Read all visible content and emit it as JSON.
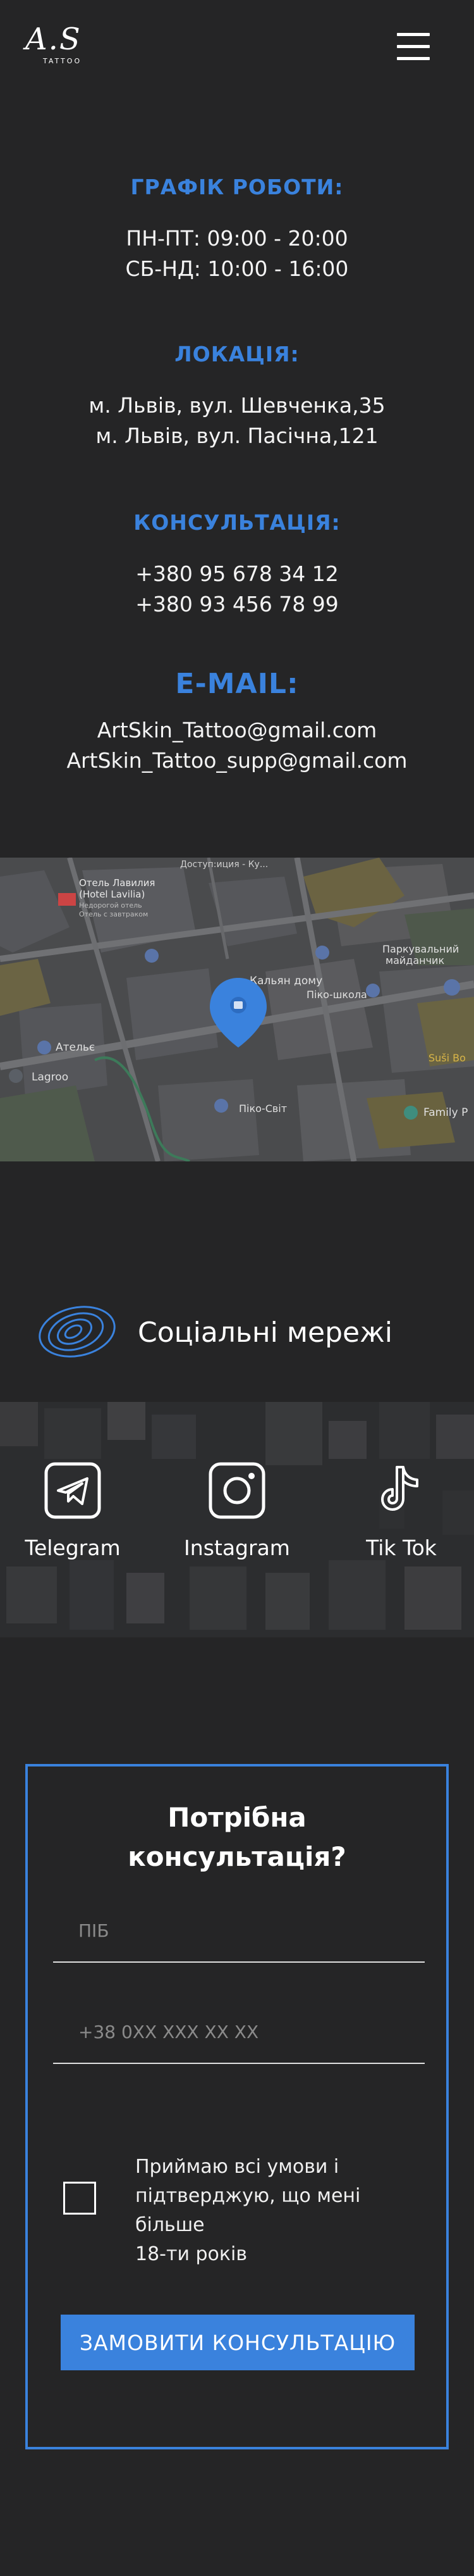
{
  "header": {
    "logo_script": "A.S",
    "logo_word": "TATTOO"
  },
  "schedule": {
    "heading": "ГРАФІК РОБОТИ:",
    "line1": "ПН-ПТ: 09:00 - 20:00",
    "line2": "СБ-НД: 10:00 - 16:00"
  },
  "location": {
    "heading": "ЛОКАЦІЯ:",
    "line1": "м. Львів, вул. Шевченка,35",
    "line2": "м. Львів, вул. Пасічна,121"
  },
  "consultation": {
    "heading": "КОНСУЛЬТАЦІЯ:",
    "line1": "+380 95 678 34 12",
    "line2": "+380 93 456 78 99"
  },
  "email": {
    "heading": "E-MAIL:",
    "line1": "ArtSkin_Tattoo@gmail.com",
    "line2": "ArtSkin_Tattoo_supp@gmail.com"
  },
  "map": {
    "labels": [
      "Доступ:иция - Ку...",
      "Отель Лавилия",
      "(Hotel Lavilia)",
      "Недорогой отель",
      "Отель с завтраком",
      "Кальян дому",
      "Паркувальний",
      "майданчик",
      "Піко-школа",
      "Ательє",
      "Lagroo",
      "Піко-Світ",
      "Family P",
      "Suši Bo"
    ],
    "pin_icon": "map-pin-icon"
  },
  "social": {
    "title": "Соціальні мережі",
    "items": [
      {
        "label": "Telegram",
        "icon": "telegram-icon"
      },
      {
        "label": "Instagram",
        "icon": "instagram-icon"
      },
      {
        "label": "Tik Tok",
        "icon": "tiktok-icon"
      }
    ]
  },
  "form": {
    "title_line1": "Потрібна",
    "title_line2": "консультація?",
    "name_placeholder": "ПІБ",
    "phone_placeholder": "+38 0XX XXX XX XX",
    "terms_line1": "Приймаю всі умови і",
    "terms_line2": "підтверджую, що мені більше",
    "terms_line3": "18-ти років",
    "submit_label": "ЗАМОВИТИ КОНСУЛЬТАЦІЮ"
  },
  "colors": {
    "background": "#252526",
    "accent": "#3a82dd",
    "text": "#ffffff"
  }
}
